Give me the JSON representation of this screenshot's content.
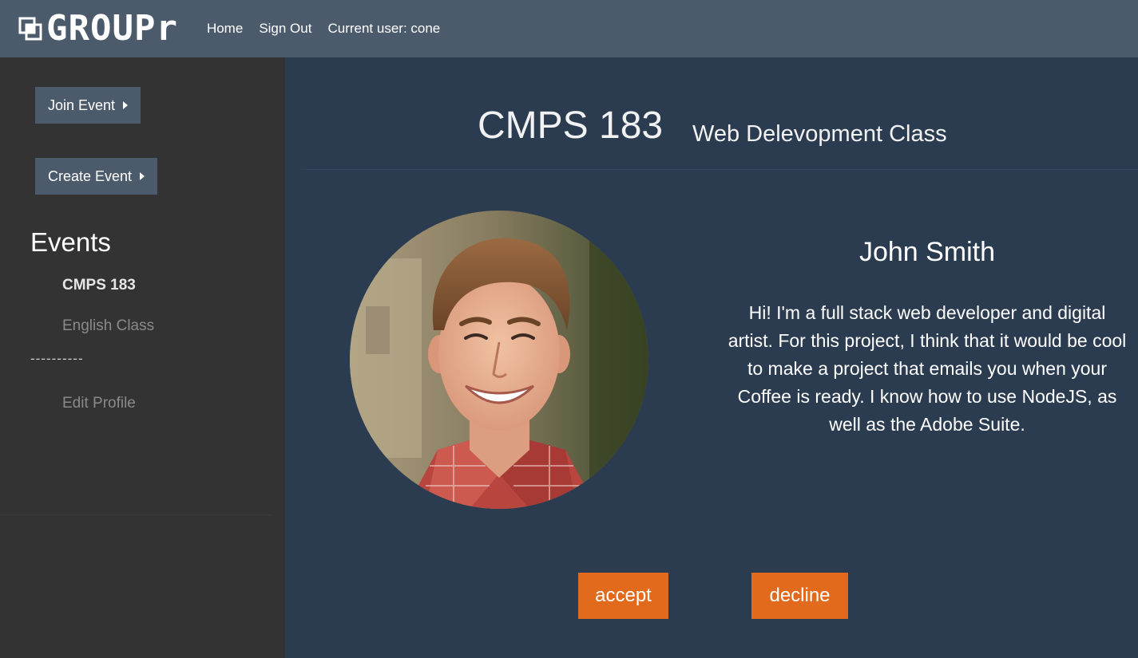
{
  "header": {
    "logo_text": "GROUPr",
    "nav": {
      "home": "Home",
      "sign_out": "Sign Out",
      "current_user": "Current user: cone"
    }
  },
  "sidebar": {
    "join_event": "Join Event",
    "create_event": "Create Event",
    "events_heading": "Events",
    "events": [
      "CMPS 183",
      "English Class"
    ],
    "separator": "----------",
    "edit_profile": "Edit Profile"
  },
  "main": {
    "event_title": "CMPS 183",
    "event_subtitle": "Web Delevopment Class",
    "person": {
      "name": "John Smith",
      "bio": "Hi! I'm a full stack web developer and digital artist. For this project, I think that it would be cool to make a project that emails you when your Coffee is ready. I know how to use NodeJS, as well as the Adobe Suite."
    },
    "accept_label": "accept",
    "decline_label": "decline"
  },
  "colors": {
    "topbar": "#4b5b6c",
    "sidebar": "#333333",
    "main_bg": "#2b3c50",
    "accent": "#e26a1c"
  },
  "icons": {
    "logo": "group-squares-icon",
    "button_caret": "caret-right-icon"
  }
}
